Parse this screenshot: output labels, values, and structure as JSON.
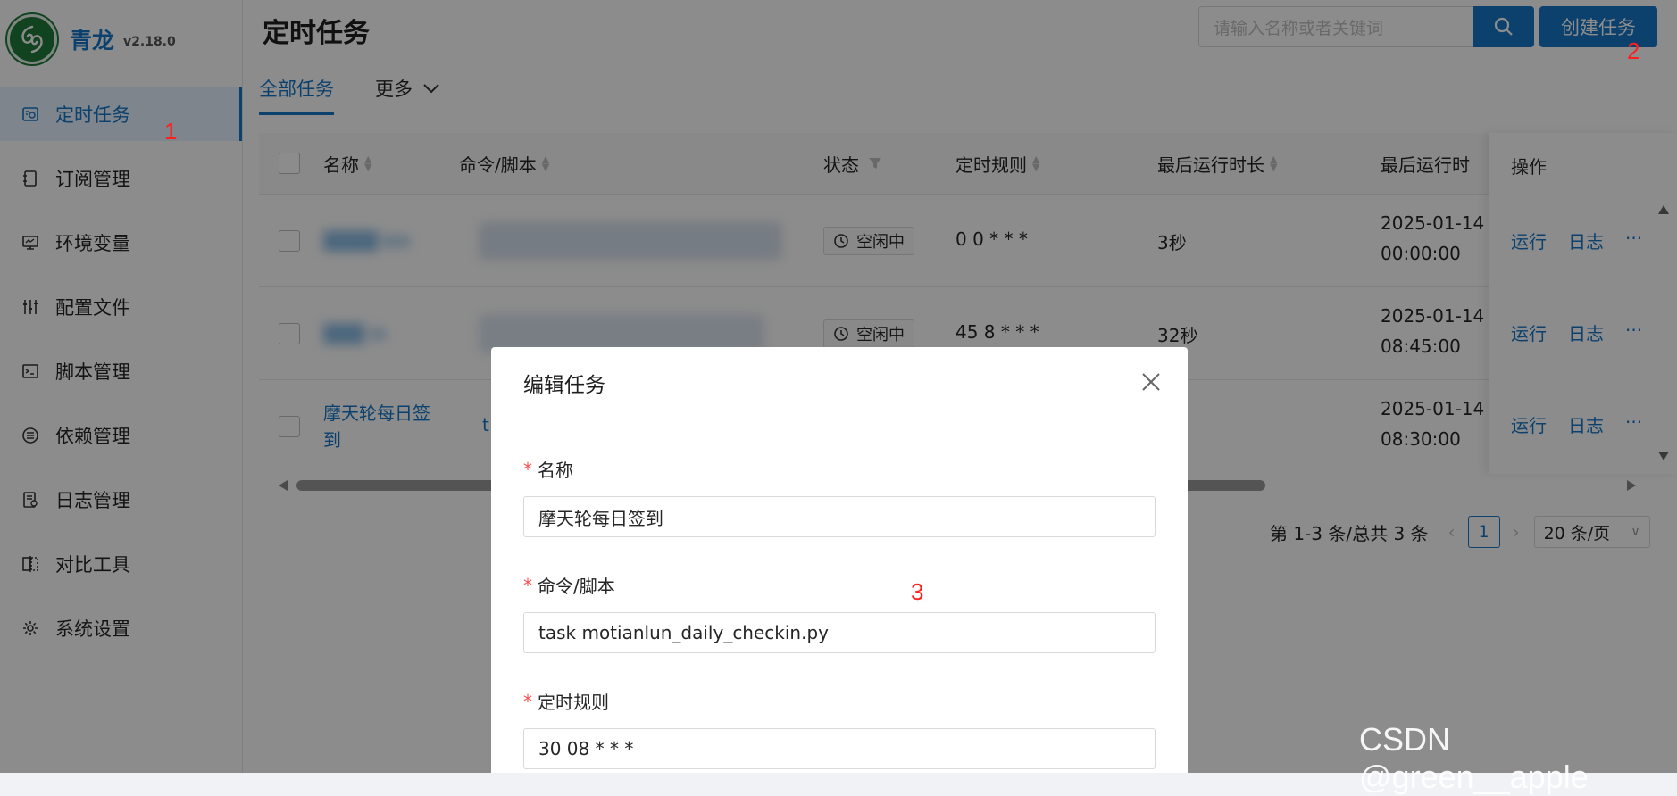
{
  "app": {
    "name": "青龙",
    "version": "v2.18.0"
  },
  "sidebar": {
    "items": [
      {
        "label": "定时任务",
        "icon": "schedule-icon"
      },
      {
        "label": "订阅管理",
        "icon": "subscription-icon"
      },
      {
        "label": "环境变量",
        "icon": "monitor-icon"
      },
      {
        "label": "配置文件",
        "icon": "sliders-icon"
      },
      {
        "label": "脚本管理",
        "icon": "code-icon"
      },
      {
        "label": "依赖管理",
        "icon": "list-icon"
      },
      {
        "label": "日志管理",
        "icon": "log-icon"
      },
      {
        "label": "对比工具",
        "icon": "diff-icon"
      },
      {
        "label": "系统设置",
        "icon": "gear-icon"
      }
    ]
  },
  "header": {
    "title": "定时任务",
    "search_placeholder": "请输入名称或者关键词",
    "create_label": "创建任务"
  },
  "tabs": {
    "all": "全部任务",
    "more": "更多"
  },
  "table": {
    "columns": [
      "名称",
      "命令/脚本",
      "状态",
      "定时规则",
      "最后运行时长",
      "最后运行时",
      "操作"
    ],
    "rows": [
      {
        "name": "",
        "command": "",
        "status": "空闲中",
        "schedule": "0 0 * * *",
        "duration": "3秒",
        "last_run_date": "2025-01-14",
        "last_run_time": "00:00:00"
      },
      {
        "name": "",
        "command": "",
        "status": "空闲中",
        "schedule": "45 8 * * *",
        "duration": "32秒",
        "last_run_date": "2025-01-14",
        "last_run_time": "08:45:00"
      },
      {
        "name": "摩天轮每日签到",
        "command": "t",
        "status": "",
        "schedule": "",
        "duration": "",
        "last_run_date": "2025-01-14",
        "last_run_time": "08:30:00"
      }
    ],
    "actions": {
      "run": "运行",
      "log": "日志",
      "more": "···"
    }
  },
  "pagination": {
    "summary": "第 1-3 条/总共 3 条",
    "current": "1",
    "page_size": "20 条/页"
  },
  "modal": {
    "title": "编辑任务",
    "fields": [
      {
        "label": "名称",
        "value": "摩天轮每日签到"
      },
      {
        "label": "命令/脚本",
        "value": "task motianlun_daily_checkin.py"
      },
      {
        "label": "定时规则",
        "value": "30 08 * * *"
      }
    ]
  },
  "annotations": {
    "a1": "1",
    "a2": "2",
    "a3": "3"
  },
  "watermark": "CSDN @green__apple",
  "colors": {
    "primary": "#1677c8",
    "required": "#ff4d4f",
    "annotation": "#ff1f1f"
  }
}
